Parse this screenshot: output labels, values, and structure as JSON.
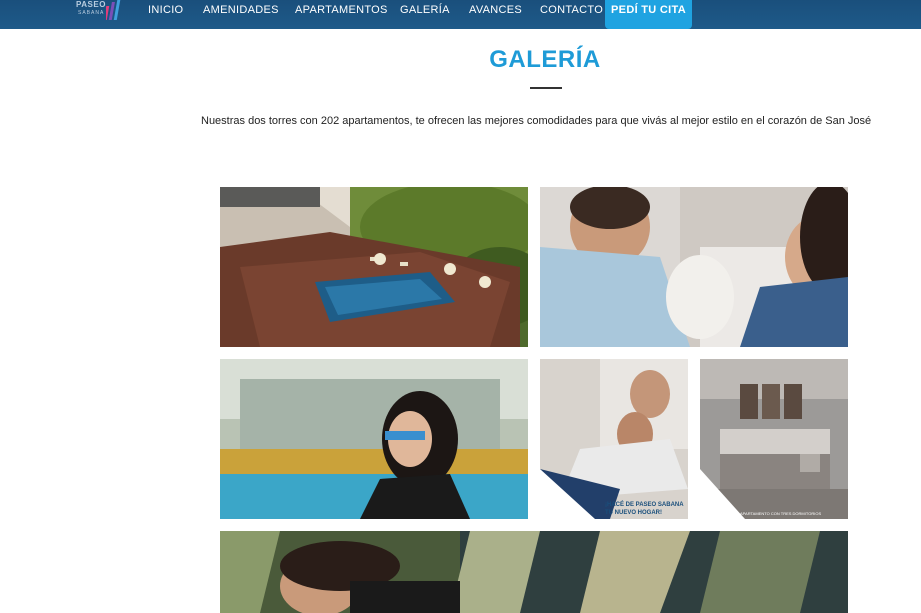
{
  "brand": {
    "logo_line1": "PASEO",
    "logo_line2": "SABANA"
  },
  "nav": {
    "items": [
      "INICIO",
      "AMENIDADES",
      "APARTAMENTOS",
      "GALERÍA",
      "AVANCES",
      "CONTACTO"
    ],
    "cta": "PEDÍ TU CITA"
  },
  "page": {
    "title": "GALERÍA",
    "intro": "Nuestras dos torres con 202 apartamentos, te ofrecen las mejores comodidades para que vivás al mejor estilo en el corazón de San José"
  },
  "gallery": {
    "promo_caption_a": "¡HACÉ DE PASEO SABANA",
    "promo_caption_b": "TU NUEVO HOGAR!",
    "bedroom_caption": "APARTAMENTO CON TRES DORMITORIOS"
  },
  "colors": {
    "nav_bg": "#1a4f7c",
    "accent": "#1fa3e1",
    "title": "#1e9bd7"
  }
}
